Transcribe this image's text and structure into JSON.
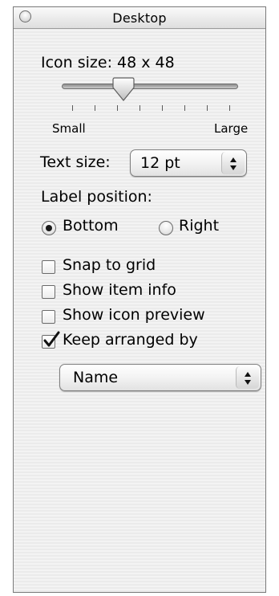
{
  "window": {
    "title": "Desktop"
  },
  "icon_size": {
    "label": "Icon size: 48 x 48",
    "min_label": "Small",
    "max_label": "Large",
    "slider_fraction": 0.33
  },
  "text_size": {
    "label": "Text size:",
    "value": "12 pt"
  },
  "label_position": {
    "label": "Label position:",
    "options": [
      {
        "label": "Bottom",
        "selected": true
      },
      {
        "label": "Right",
        "selected": false
      }
    ]
  },
  "checkboxes": [
    {
      "label": "Snap to grid",
      "checked": false
    },
    {
      "label": "Show item info",
      "checked": false
    },
    {
      "label": "Show icon preview",
      "checked": false
    },
    {
      "label": "Keep arranged by",
      "checked": true
    }
  ],
  "arrange_by": {
    "value": "Name"
  }
}
